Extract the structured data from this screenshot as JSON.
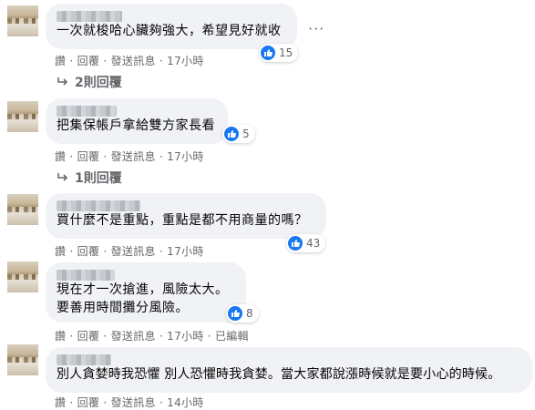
{
  "comments": [
    {
      "text_lines": [
        "一次就梭哈心臟夠強大，希望見好就收"
      ],
      "reaction_count": "15",
      "actions": {
        "like": "讚",
        "reply": "回覆",
        "message": "發送訊息",
        "time": "17小時",
        "edited": ""
      },
      "replies_label": "2則回覆"
    },
    {
      "text_lines": [
        "把集保帳戶拿給雙方家長看"
      ],
      "reaction_count": "5",
      "actions": {
        "like": "讚",
        "reply": "回覆",
        "message": "發送訊息",
        "time": "17小時",
        "edited": ""
      },
      "replies_label": "1則回覆"
    },
    {
      "text_lines": [
        "買什麼不是重點，重點是都不用商量的嗎？"
      ],
      "reaction_count": "43",
      "actions": {
        "like": "讚",
        "reply": "回覆",
        "message": "發送訊息",
        "time": "17小時",
        "edited": ""
      },
      "replies_label": ""
    },
    {
      "text_lines": [
        "現在才一次搶進，風險太大。",
        "要善用時間攤分風險。"
      ],
      "reaction_count": "8",
      "actions": {
        "like": "讚",
        "reply": "回覆",
        "message": "發送訊息",
        "time": "17小時",
        "edited": "已編輯"
      },
      "replies_label": ""
    },
    {
      "text_lines": [
        "別人貪婪時我恐懼 別人恐懼時我貪婪。當大家都說漲時候就是要小心的時候。"
      ],
      "reaction_count": "",
      "actions": {
        "like": "讚",
        "reply": "回覆",
        "message": "發送訊息",
        "time": "14小時",
        "edited": ""
      },
      "replies_label": ""
    }
  ],
  "icons": {
    "like": "thumbs-up-icon",
    "more": "more-options-icon",
    "reply_arrow": "reply-arrow-icon"
  },
  "colors": {
    "bubble": "#f0f2f5",
    "like": "#1877f2",
    "meta": "#65676b"
  },
  "separator": " · "
}
